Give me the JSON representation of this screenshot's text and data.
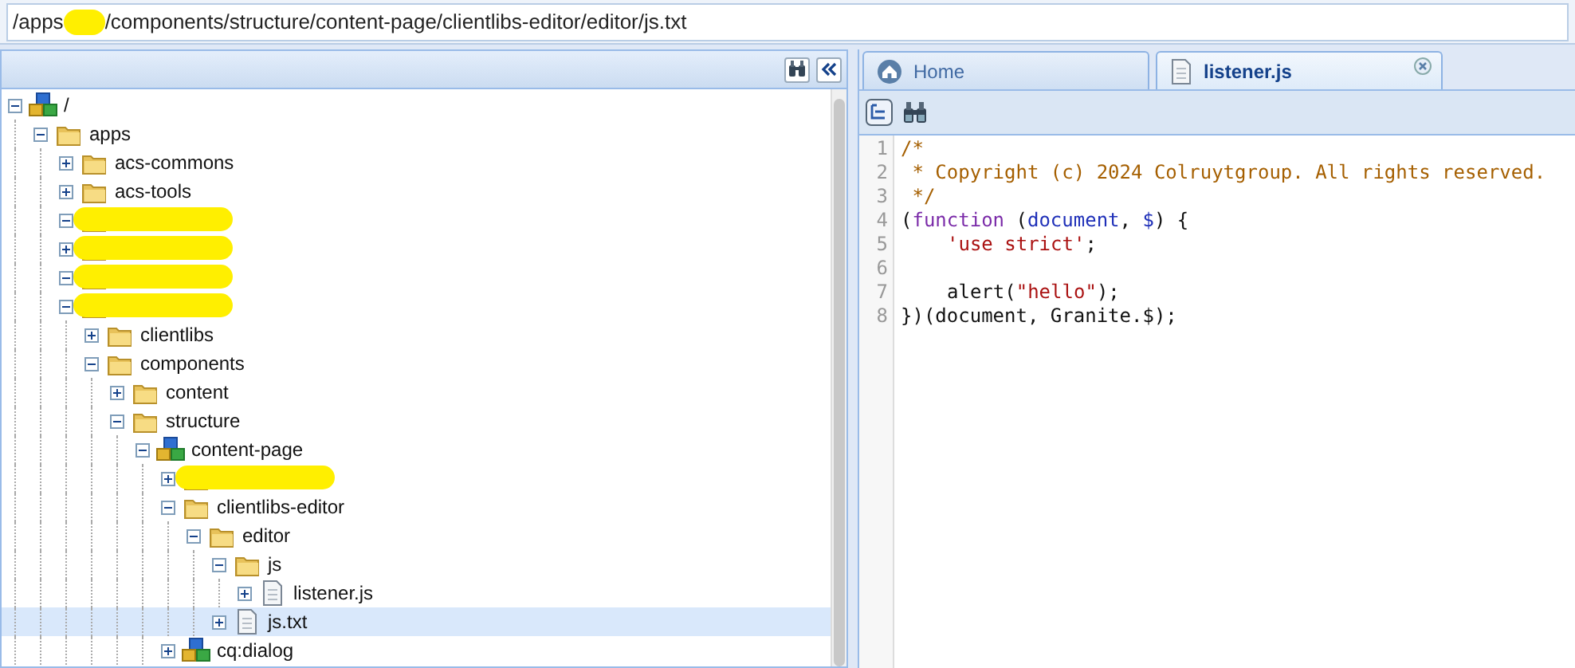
{
  "path_bar": {
    "before": "/apps",
    "after": "/components/structure/content-page/clientlibs-editor/editor/js.txt",
    "redacted": true
  },
  "tree": [
    {
      "label": "/",
      "kind": "root",
      "expanded": true,
      "selected": false,
      "children": [
        {
          "label": "apps",
          "kind": "folder",
          "expanded": true,
          "selected": false,
          "children": [
            {
              "label": "acs-commons",
              "kind": "folder",
              "expanded": false,
              "selected": false
            },
            {
              "label": "acs-tools",
              "kind": "folder",
              "expanded": false,
              "selected": false
            },
            {
              "redacted": true,
              "kind": "folder",
              "expanded": true,
              "selected": false
            },
            {
              "redacted": true,
              "kind": "folder",
              "expanded": false,
              "selected": false
            },
            {
              "redacted": true,
              "kind": "folder",
              "expanded": true,
              "selected": false
            },
            {
              "redacted": true,
              "kind": "folder",
              "expanded": true,
              "selected": false,
              "children": [
                {
                  "label": "clientlibs",
                  "kind": "folder",
                  "expanded": false,
                  "selected": false
                },
                {
                  "label": "components",
                  "kind": "folder",
                  "expanded": true,
                  "selected": false,
                  "children": [
                    {
                      "label": "content",
                      "kind": "folder",
                      "expanded": false,
                      "selected": false
                    },
                    {
                      "label": "structure",
                      "kind": "folder",
                      "expanded": true,
                      "selected": false,
                      "children": [
                        {
                          "label": "content-page",
                          "kind": "component",
                          "expanded": true,
                          "selected": false,
                          "children": [
                            {
                              "redacted": true,
                              "kind": "folder",
                              "expanded": false,
                              "selected": false
                            },
                            {
                              "label": "clientlibs-editor",
                              "kind": "folder",
                              "expanded": true,
                              "selected": false,
                              "children": [
                                {
                                  "label": "editor",
                                  "kind": "folder",
                                  "expanded": true,
                                  "selected": false,
                                  "children": [
                                    {
                                      "label": "js",
                                      "kind": "folder",
                                      "expanded": true,
                                      "selected": false,
                                      "children": [
                                        {
                                          "label": "listener.js",
                                          "kind": "file",
                                          "expanded": false,
                                          "selected": false
                                        }
                                      ]
                                    },
                                    {
                                      "label": "js.txt",
                                      "kind": "file",
                                      "expanded": false,
                                      "selected": true
                                    }
                                  ]
                                }
                              ]
                            },
                            {
                              "label": "cq:dialog",
                              "kind": "component",
                              "expanded": false,
                              "selected": false
                            }
                          ]
                        }
                      ]
                    }
                  ]
                }
              ]
            }
          ]
        }
      ]
    }
  ],
  "tabs": [
    {
      "label": "Home",
      "selected": false
    },
    {
      "label": "listener.js",
      "selected": true,
      "closable": true
    }
  ],
  "code_lines": [
    {
      "number": "1",
      "tokens": [
        {
          "kind": "comment",
          "text": "/*"
        }
      ]
    },
    {
      "number": "2",
      "tokens": [
        {
          "kind": "comment",
          "text": " * Copyright (c) 2024 Colruytgroup. All rights reserved."
        }
      ]
    },
    {
      "number": "3",
      "tokens": [
        {
          "kind": "comment",
          "text": " */"
        }
      ]
    },
    {
      "number": "4",
      "tokens": [
        {
          "kind": "plain",
          "text": "("
        },
        {
          "kind": "keyword",
          "text": "function"
        },
        {
          "kind": "plain",
          "text": " ("
        },
        {
          "kind": "variable",
          "text": "document"
        },
        {
          "kind": "plain",
          "text": ", "
        },
        {
          "kind": "variable",
          "text": "$"
        },
        {
          "kind": "plain",
          "text": ") {"
        }
      ]
    },
    {
      "number": "5",
      "indented": true,
      "tokens": [
        {
          "kind": "string",
          "text": "'use strict'"
        },
        {
          "kind": "plain",
          "text": ";"
        }
      ]
    },
    {
      "number": "6"
    },
    {
      "number": "7",
      "indented": true,
      "tokens": [
        {
          "kind": "plain",
          "text": "alert("
        },
        {
          "kind": "string",
          "text": "\"hello\""
        },
        {
          "kind": "plain",
          "text": ");"
        }
      ]
    },
    {
      "number": "8",
      "tokens": [
        {
          "kind": "plain",
          "text": "})(document, Granite.$);"
        }
      ]
    }
  ]
}
